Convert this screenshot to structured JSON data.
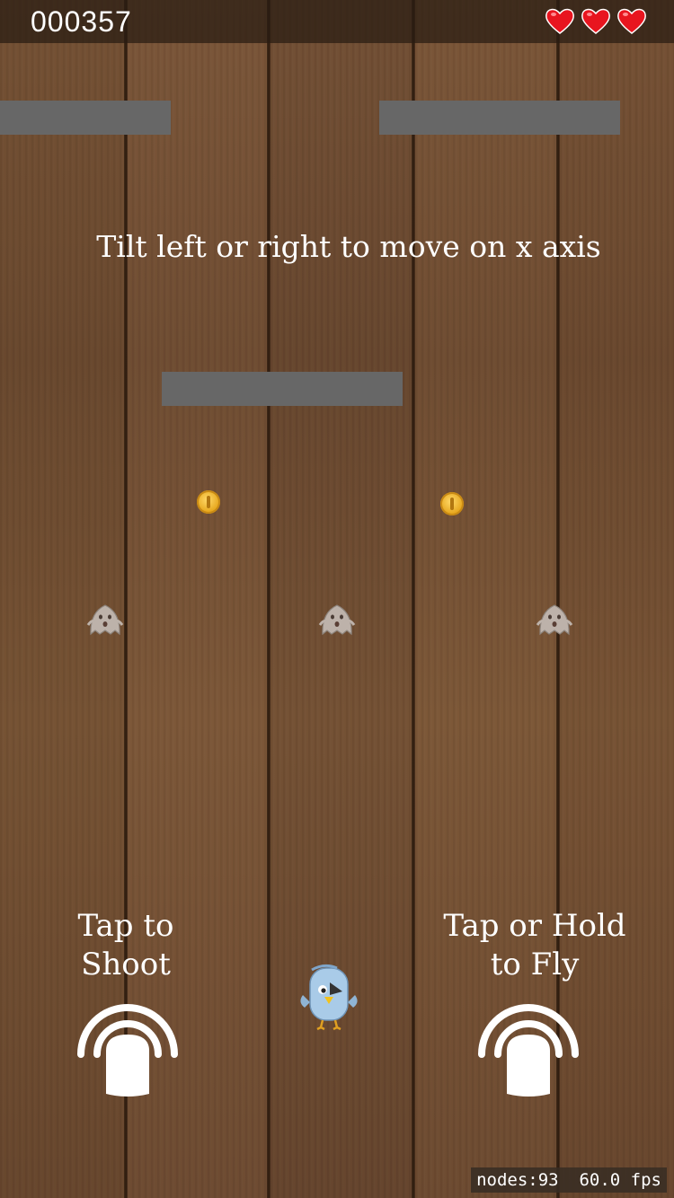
{
  "hud": {
    "score": "000357",
    "lives": 3,
    "heart_icon": "heart-icon",
    "heart_color": "#e8151f"
  },
  "hint_text": "Tilt left or right to move on x axis",
  "controls": {
    "shoot_line1": "Tap to",
    "shoot_line2": "Shoot",
    "fly_line1": "Tap or Hold",
    "fly_line2": "to Fly",
    "icon": "tap-gesture-icon"
  },
  "entities": {
    "coin_icon": "coin-icon",
    "coin_color": "#e6a61c",
    "ghost_icon": "ghost-icon",
    "player_icon": "blue-bird-player-icon",
    "platform_color": "#676767"
  },
  "debug": {
    "nodes": "nodes:93",
    "fps": "60.0 fps"
  }
}
